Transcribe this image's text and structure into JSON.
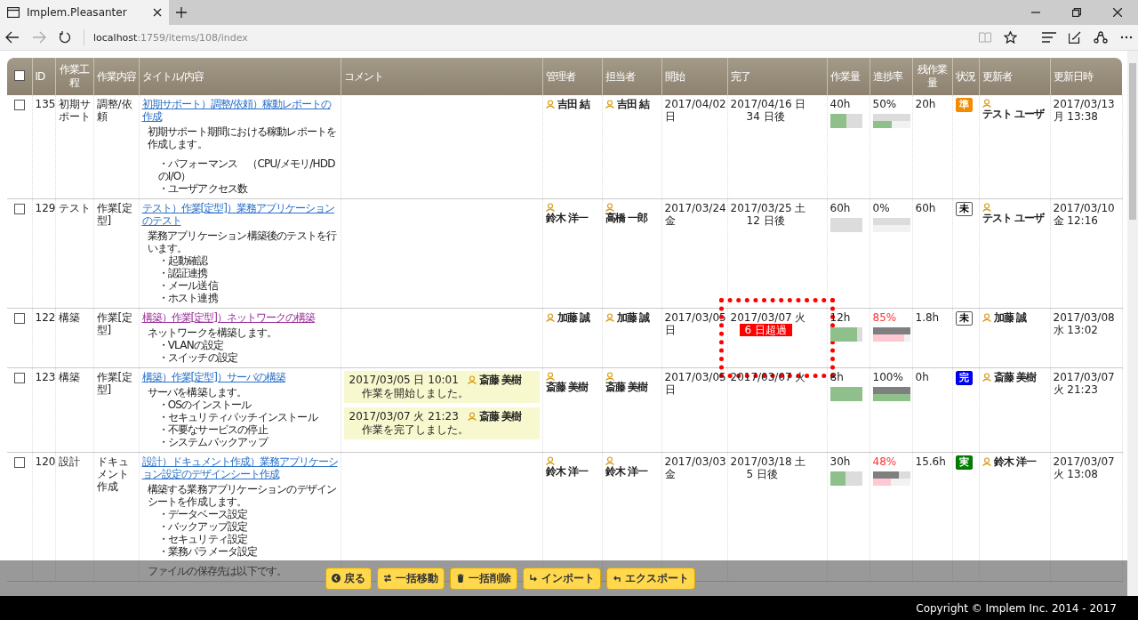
{
  "browser": {
    "tab_title": "Implem.Pleasanter",
    "address_host": "localhost",
    "address_path": ":1759/items/108/index",
    "forward_disabled": true
  },
  "table": {
    "select_all": {
      "checked": false
    },
    "columns": [
      "ID",
      "作業工程",
      "作業内容",
      "タイトル/内容",
      "コメント",
      "管理者",
      "担当者",
      "開始",
      "完了",
      "作業量",
      "進捗率",
      "残作業量",
      "状況",
      "更新者",
      "更新日時"
    ],
    "rows": [
      {
        "selected": false,
        "id": "135",
        "process": "初期サポート",
        "content": "調整/依頼",
        "title": "初期サポート）調整/依頼）稼動レポートの作成",
        "visited": false,
        "description": [
          {
            "kind": "para",
            "text": "初期サポート期間における稼動レポートを作成します。"
          },
          {
            "kind": "bullet",
            "text": "・パフォーマンス　（CPU/メモリ/HDDのI/O）",
            "gap_before": true
          },
          {
            "kind": "bullet",
            "text": "・ユーザアクセス数"
          }
        ],
        "comments": [],
        "manager": "吉田 結",
        "assignee": "吉田 結",
        "start": "2017/04/02 日",
        "end": "2017/04/16 日",
        "end_note": {
          "kind": "remaining",
          "text": "34 日後"
        },
        "volume": "40h",
        "volume_fill": {
          "level": 0.5
        },
        "progress": "50%",
        "delayed": false,
        "planned": {
          "level": 0
        },
        "actual": {
          "level": 0.5
        },
        "remaining": "20h",
        "status": {
          "label": "準",
          "kind": "preparing"
        },
        "updater": "テスト ユーザ",
        "updated": "2017/03/13 月 13:38"
      },
      {
        "selected": false,
        "id": "129",
        "process": "テスト",
        "content": "作業[定型]",
        "title": "テスト）作業[定型]）業務アプリケーションのテスト",
        "visited": false,
        "description": [
          {
            "kind": "para",
            "text": "業務アプリケーション構築後のテストを行います。"
          },
          {
            "kind": "bullet",
            "text": "・起動確認"
          },
          {
            "kind": "bullet",
            "text": "・認証連携"
          },
          {
            "kind": "bullet",
            "text": "・メール送信"
          },
          {
            "kind": "bullet",
            "text": "・ホスト連携"
          }
        ],
        "comments": [],
        "manager": "鈴木 洋一",
        "assignee": "高橋 一郎",
        "start": "2017/03/24 金",
        "end": "2017/03/25 土",
        "end_note": {
          "kind": "remaining",
          "text": "12 日後"
        },
        "volume": "60h",
        "volume_fill": {
          "level": 0
        },
        "progress": "0%",
        "delayed": false,
        "planned": {
          "level": 0
        },
        "actual": {
          "level": 0
        },
        "remaining": "60h",
        "status": {
          "label": "未",
          "kind": "not_started"
        },
        "updater": "テスト ユーザ",
        "updated": "2017/03/10 金 12:16"
      },
      {
        "selected": false,
        "id": "122",
        "process": "構築",
        "content": "作業[定型]",
        "title": "構築）作業[定型]）ネットワークの構築",
        "visited": true,
        "description": [
          {
            "kind": "para",
            "text": "ネットワークを構築します。"
          },
          {
            "kind": "bullet",
            "text": "・VLANの設定"
          },
          {
            "kind": "bullet",
            "text": "・スイッチの設定"
          }
        ],
        "comments": [],
        "manager": "加藤 誠",
        "assignee": "加藤 誠",
        "start": "2017/03/05 日",
        "end": "2017/03/07 火",
        "end_note": {
          "kind": "overdue",
          "text": "6 日超過"
        },
        "highlighted": true,
        "volume": "12h",
        "volume_fill": {
          "level": 0.85
        },
        "progress": "85%",
        "delayed": true,
        "planned": {
          "level": 1
        },
        "actual": {
          "level": 0.85
        },
        "remaining": "1.8h",
        "status": {
          "label": "未",
          "kind": "not_started"
        },
        "updater": "加藤 誠",
        "updated": "2017/03/08 水 13:02"
      },
      {
        "selected": false,
        "id": "123",
        "process": "構築",
        "content": "作業[定型]",
        "title": "構築）作業[定型]）サーバの構築",
        "visited": false,
        "description": [
          {
            "kind": "para",
            "text": "サーバを構築します。"
          },
          {
            "kind": "bullet",
            "text": "・OSのインストール"
          },
          {
            "kind": "bullet",
            "text": "・セキュリティパッチインストール"
          },
          {
            "kind": "bullet",
            "text": "・不要なサービスの停止"
          },
          {
            "kind": "bullet",
            "text": "・システムバックアップ"
          }
        ],
        "comments": [
          {
            "time": "2017/03/05 日 10:01",
            "user": "斎藤 美樹",
            "text": "作業を開始しました。"
          },
          {
            "time": "2017/03/07 火 21:23",
            "user": "斎藤 美樹",
            "text": "作業を完了しました。"
          }
        ],
        "manager": "斎藤 美樹",
        "assignee": "斎藤 美樹",
        "start": "2017/03/05 日",
        "end": "2017/03/07 火",
        "volume": "8h",
        "volume_fill": {
          "level": 1
        },
        "progress": "100%",
        "delayed": false,
        "planned": {
          "level": 1
        },
        "actual": {
          "level": 1
        },
        "remaining": "0h",
        "status": {
          "label": "完",
          "kind": "done"
        },
        "updater": "斎藤 美樹",
        "updated": "2017/03/07 火 21:23"
      },
      {
        "selected": false,
        "id": "120",
        "process": "設計",
        "content": "ドキュメント作成",
        "title": "設計）ドキュメント作成）業務アプリケーション設定のデザインシート作成",
        "visited": false,
        "description": [
          {
            "kind": "para",
            "text": "構築する業務アプリケーションのデザインシートを作成します。"
          },
          {
            "kind": "bullet",
            "text": "・データベース設定"
          },
          {
            "kind": "bullet",
            "text": "・バックアップ設定"
          },
          {
            "kind": "bullet",
            "text": "・セキュリティ設定"
          },
          {
            "kind": "bullet",
            "text": "・業務パラメータ設定"
          },
          {
            "kind": "para",
            "text": "ファイルの保存先は以下です。",
            "gap_before": true
          }
        ],
        "comments": [],
        "manager": "鈴木 洋一",
        "assignee": "鈴木 洋一",
        "start": "2017/03/03 金",
        "end": "2017/03/18 土",
        "end_note": {
          "kind": "remaining",
          "text": "5 日後"
        },
        "volume": "30h",
        "volume_fill": {
          "level": 0.48
        },
        "progress": "48%",
        "delayed": true,
        "planned": {
          "level": 0.7
        },
        "actual": {
          "level": 0.48
        },
        "remaining": "15.6h",
        "status": {
          "label": "実",
          "kind": "in_progress"
        },
        "updater": "鈴木 洋一",
        "updated": "2017/03/07 火 13:08"
      }
    ]
  },
  "commands": [
    {
      "label": "戻る",
      "kind": "back"
    },
    {
      "label": "一括移動",
      "kind": "move"
    },
    {
      "label": "一括削除",
      "kind": "delete"
    },
    {
      "label": "インポート",
      "kind": "import"
    },
    {
      "label": "エクスポート",
      "kind": "export"
    }
  ],
  "footer": "Copyright © Implem Inc. 2014 - 2017"
}
